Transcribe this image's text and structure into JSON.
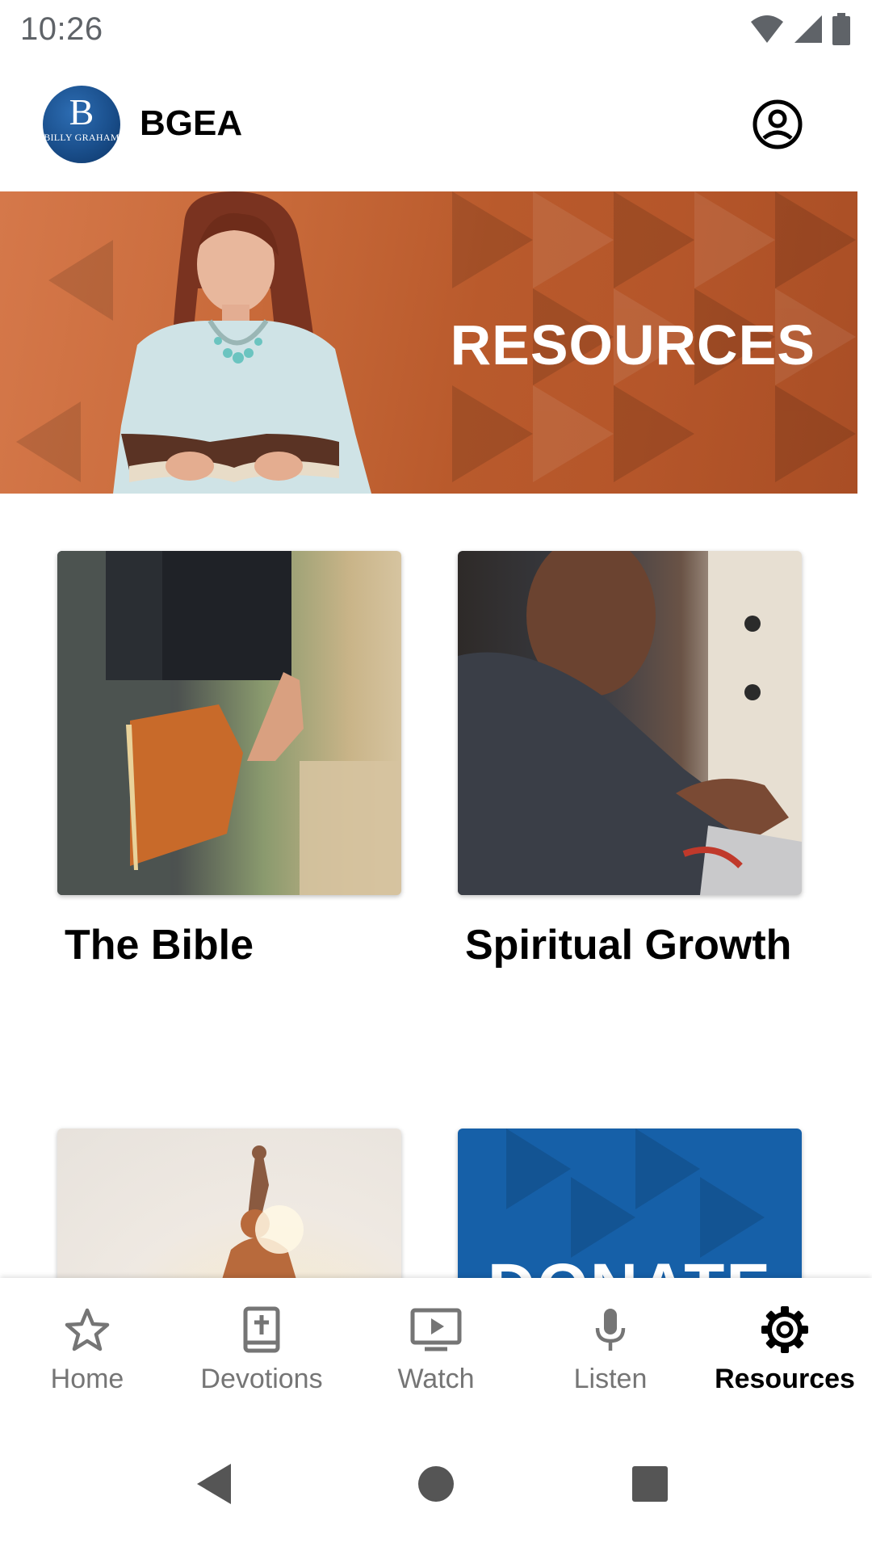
{
  "status_bar": {
    "time": "10:26",
    "icons": [
      "wifi-icon",
      "cell-signal-icon",
      "battery-icon"
    ]
  },
  "app_bar": {
    "logo_letter": "B",
    "logo_subtext": "BILLY GRAHAM",
    "title": "BGEA",
    "account_icon": "account-circle-icon"
  },
  "hero": {
    "title": "RESOURCES"
  },
  "cards": [
    {
      "label": "The Bible"
    },
    {
      "label": "Spiritual Growth"
    },
    {
      "label": ""
    },
    {
      "overlay_text": "DONATE"
    }
  ],
  "bottom_nav": {
    "items": [
      {
        "label": "Home",
        "icon": "star-icon",
        "active": false
      },
      {
        "label": "Devotions",
        "icon": "book-cross-icon",
        "active": false
      },
      {
        "label": "Watch",
        "icon": "tv-play-icon",
        "active": false
      },
      {
        "label": "Listen",
        "icon": "microphone-icon",
        "active": false
      },
      {
        "label": "Resources",
        "icon": "gear-icon",
        "active": true
      }
    ]
  },
  "colors": {
    "hero_orange": "#c86a3a",
    "donate_blue": "#1660a8",
    "inactive_nav": "#757575",
    "active_nav": "#000000",
    "logo_blue": "#1a4f8c"
  }
}
